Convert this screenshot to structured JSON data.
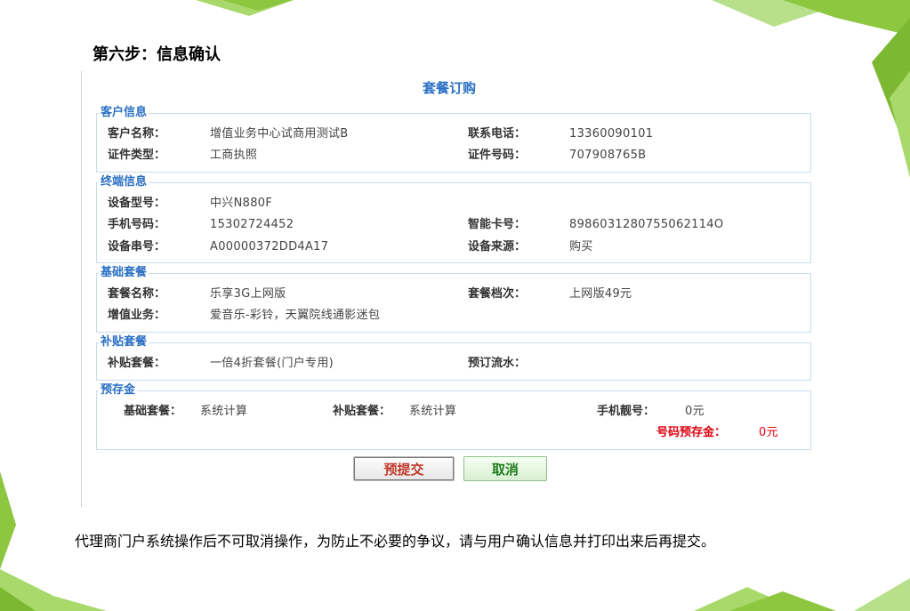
{
  "page": {
    "step_title": "第六步：信息确认"
  },
  "form": {
    "title": "套餐订购",
    "customer": {
      "legend": "客户信息",
      "name_label": "客户名称：",
      "name_value": "增值业务中心试商用测试B",
      "phone_label": "联系电话：",
      "phone_value": "13360090101",
      "idtype_label": "证件类型：",
      "idtype_value": "工商执照",
      "idno_label": "证件号码：",
      "idno_value": "707908765B"
    },
    "terminal": {
      "legend": "终端信息",
      "model_label": "设备型号：",
      "model_value": "中兴N880F",
      "mobile_label": "手机号码：",
      "mobile_value": "15302724452",
      "card_label": "智能卡号：",
      "card_value": "8986031280755062114O",
      "serial_label": "设备串号：",
      "serial_value": "A00000372DD4A17",
      "source_label": "设备来源：",
      "source_value": "购买"
    },
    "basic": {
      "legend": "基础套餐",
      "pkg_label": "套餐名称：",
      "pkg_value": "乐享3G上网版",
      "tier_label": "套餐档次：",
      "tier_value": "上网版49元",
      "vas_label": "增值业务：",
      "vas_value": "爱音乐-彩铃，天翼院线通影迷包"
    },
    "subsidy": {
      "legend": "补贴套餐",
      "pkg_label": "补贴套餐：",
      "pkg_value": "一倍4折套餐(门户专用)",
      "flow_label": "预订流水：",
      "flow_value": ""
    },
    "deposit": {
      "legend": "预存金",
      "basic_label": "基础套餐：",
      "basic_value": "系统计算",
      "subsidy_label": "补贴套餐：",
      "subsidy_value": "系统计算",
      "pretty_label": "手机靓号：",
      "pretty_value": "0元",
      "number_label": "号码预存金：",
      "number_value": "0元"
    },
    "buttons": {
      "submit": "预提交",
      "cancel": "取消"
    }
  },
  "note": "代理商门户系统操作后不可取消操作，为防止不必要的争议，请与用户确认信息并打印出来后再提交。",
  "colors": {
    "accent": "#2a6fc4",
    "warning": "#e0000f",
    "decoration": "#8dc63f"
  }
}
